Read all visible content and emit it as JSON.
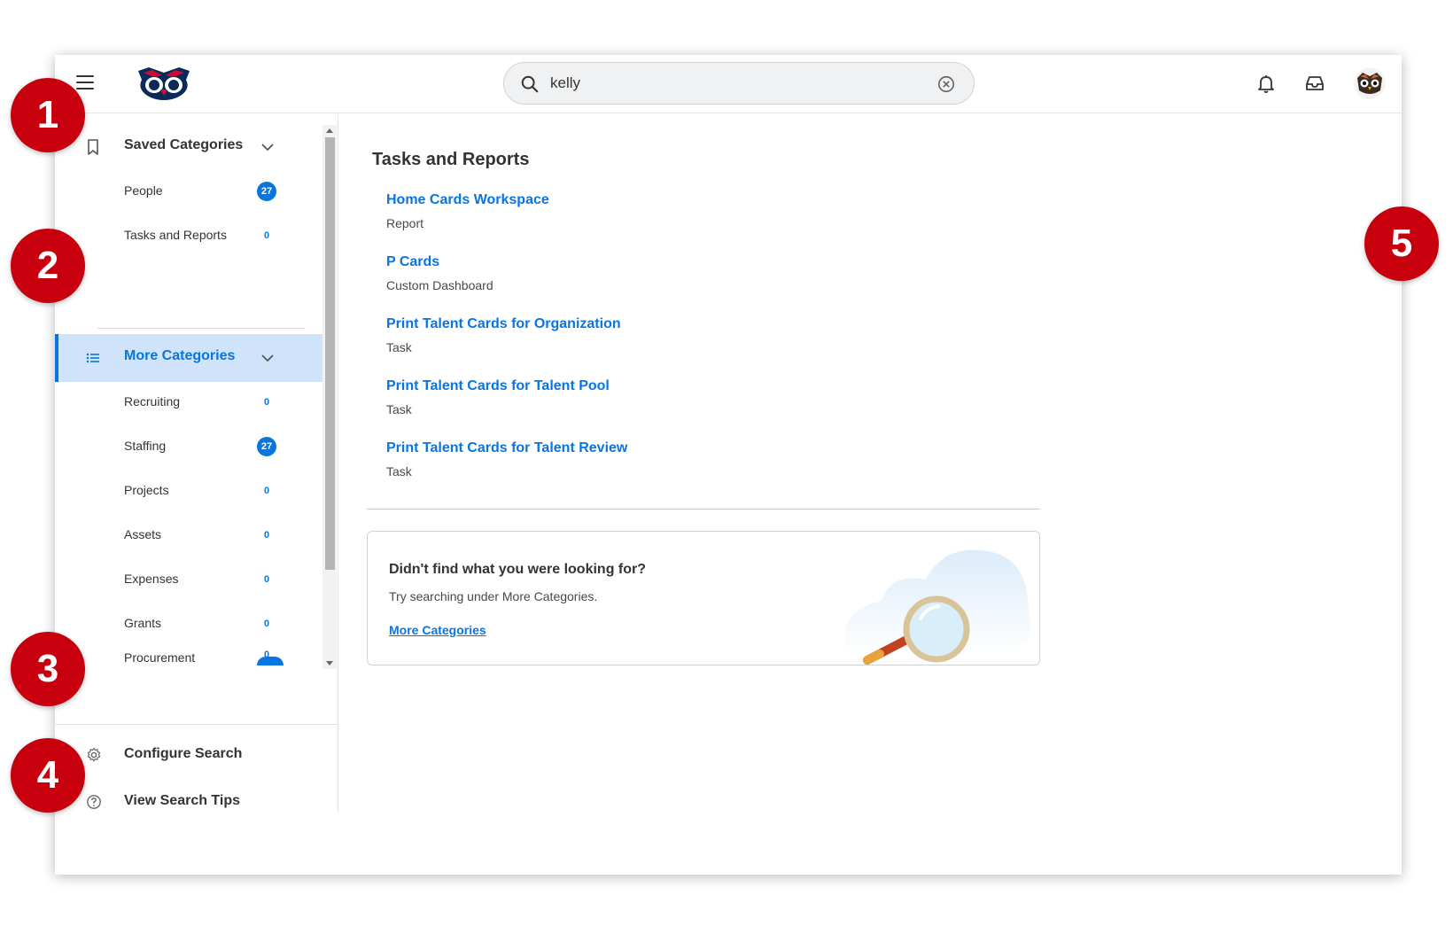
{
  "search": {
    "value": "kelly",
    "placeholder": ""
  },
  "sidebar": {
    "saved": {
      "label": "Saved Categories",
      "items": [
        {
          "label": "People",
          "count": "27"
        },
        {
          "label": "Tasks and Reports",
          "count": "0"
        }
      ]
    },
    "more": {
      "label": "More Categories",
      "items": [
        {
          "label": "Recruiting",
          "count": "0"
        },
        {
          "label": "Staffing",
          "count": "27"
        },
        {
          "label": "Projects",
          "count": "0"
        },
        {
          "label": "Assets",
          "count": "0"
        },
        {
          "label": "Expenses",
          "count": "0"
        },
        {
          "label": "Grants",
          "count": "0"
        },
        {
          "label": "Procurement",
          "count": "0"
        }
      ]
    },
    "configure_label": "Configure Search",
    "tips_label": "View Search Tips"
  },
  "main": {
    "title": "Tasks and Reports",
    "results": [
      {
        "title": "Home Cards Workspace",
        "type": "Report"
      },
      {
        "title": "P Cards",
        "type": "Custom Dashboard"
      },
      {
        "title": "Print Talent Cards for Organization",
        "type": "Task"
      },
      {
        "title": "Print Talent Cards for Talent Pool",
        "type": "Task"
      },
      {
        "title": "Print Talent Cards for Talent Review",
        "type": "Task"
      }
    ],
    "card": {
      "title": "Didn't find what you were looking for?",
      "subtitle": "Try searching under More Categories.",
      "link": "More Categories"
    }
  },
  "markers": [
    "1",
    "2",
    "3",
    "4",
    "5"
  ],
  "colors": {
    "accent": "#0875e1",
    "marker": "#c8000e",
    "active_bg": "#cfe4fb"
  },
  "icons": [
    "menu-icon",
    "owl-logo",
    "search-icon",
    "clear-icon",
    "bell-icon",
    "inbox-icon",
    "bookmark-icon",
    "list-icon",
    "gear-icon",
    "help-icon",
    "chevron-down-icon",
    "magnifier-illustration"
  ]
}
